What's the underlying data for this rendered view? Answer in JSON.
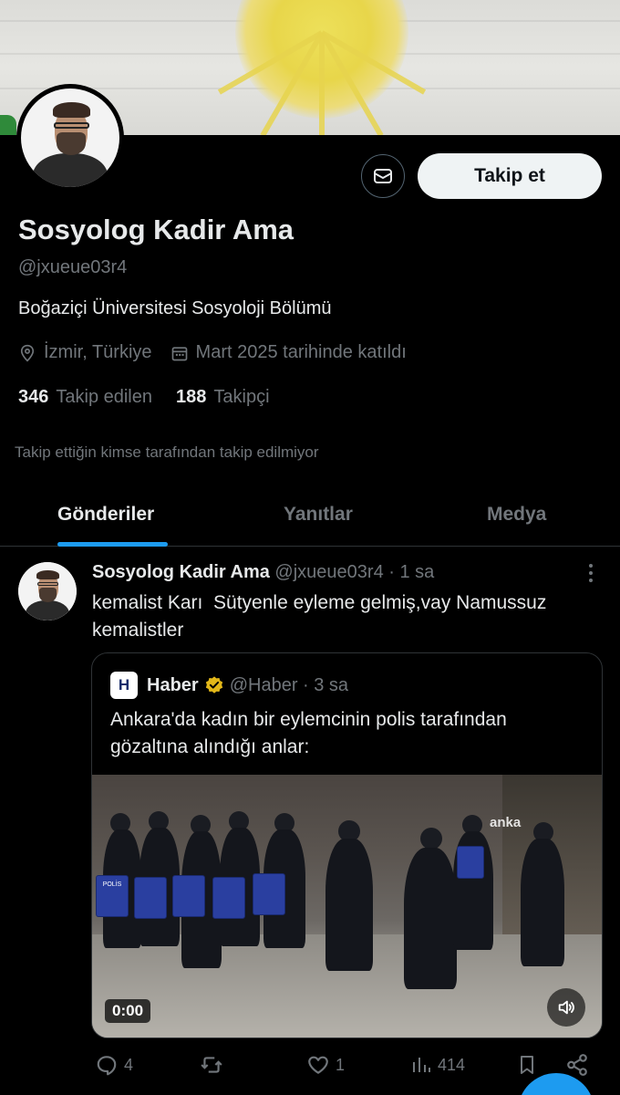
{
  "profile": {
    "name": "Sosyolog Kadir Ama",
    "handle": "@jxueue03r4",
    "bio": "Boğaziçi Üniversitesi Sosyoloji Bölümü",
    "location": "İzmir, Türkiye",
    "joined": "Mart 2025 tarihinde katıldı",
    "following_count": "346",
    "following_label": "Takip edilen",
    "followers_count": "188",
    "followers_label": "Takipçi",
    "follow_note": "Takip ettiğin kimse tarafından takip edilmiyor",
    "follow_button": "Takip et"
  },
  "tabs": [
    {
      "label": "Gönderiler",
      "active": true
    },
    {
      "label": "Yanıtlar",
      "active": false
    },
    {
      "label": "Medya",
      "active": false
    }
  ],
  "post": {
    "author": "Sosyolog Kadir Ama",
    "handle_time": "@jxueue03r4 · 1 sa",
    "text": "kemalist Karı  Sütyenle eyleme gelmiş,vay Namussuz kemalistler",
    "quote": {
      "logo_letter": "H",
      "name": "Haber",
      "handle_time": "@Haber · 3 sa",
      "text": "Ankara'da kadın bir eylemcinin polis tarafından gözaltına alındığı anlar:",
      "video_time": "0:00",
      "video_watermark": "anka",
      "shield_text": "POLİS"
    },
    "actions": {
      "replies": "4",
      "reposts": "",
      "likes": "1",
      "views": "414"
    }
  },
  "colors": {
    "accent": "#1d9bf0",
    "verified": "#e2b719",
    "muted": "#71767b"
  },
  "icons": [
    "envelope-icon",
    "location-pin-icon",
    "calendar-icon",
    "verified-badge-icon",
    "reply-icon",
    "repost-icon",
    "like-icon",
    "views-icon",
    "bookmark-icon",
    "share-icon",
    "more-icon",
    "volume-icon"
  ]
}
